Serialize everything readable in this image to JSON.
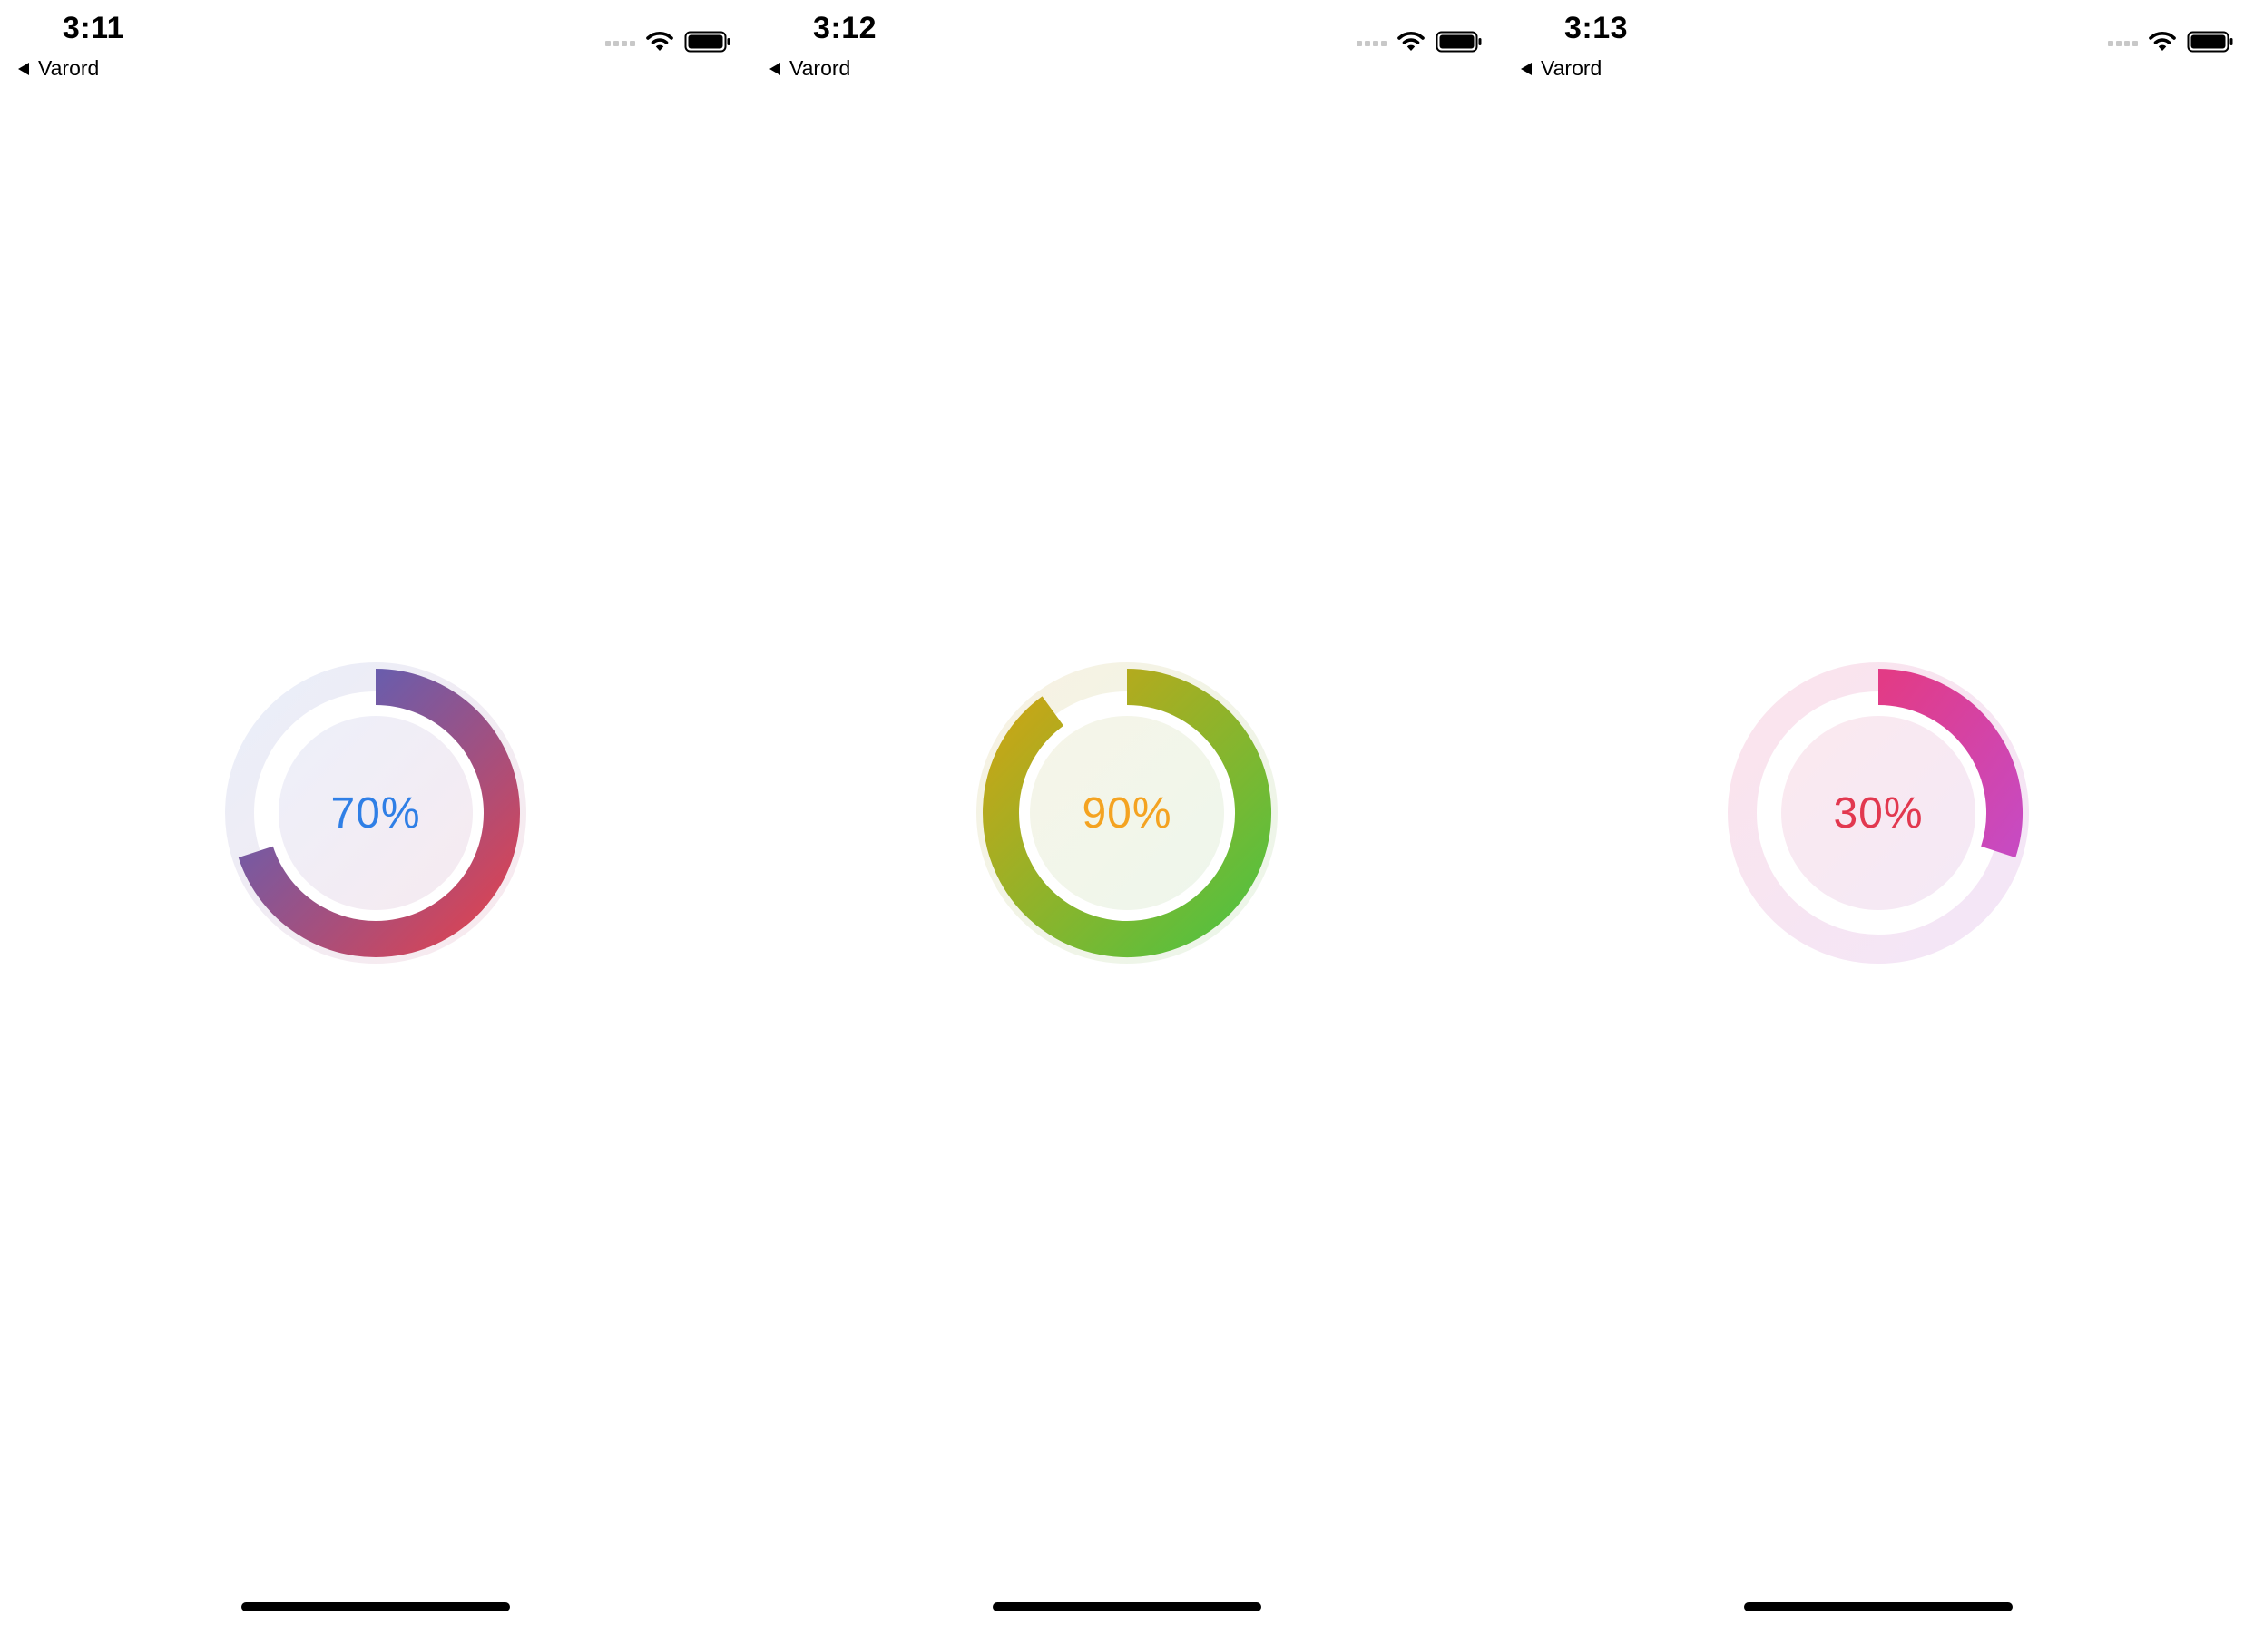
{
  "screens": [
    {
      "status": {
        "time": "3:11",
        "back_label": "Varord"
      },
      "progress": {
        "value": 0.7,
        "label": "70%"
      },
      "colors": {
        "label": "#2f7fe6",
        "track_start": "#e9eef9",
        "track_end": "#f9eaee",
        "inner_start": "#edf0fa",
        "inner_end": "#f6eaf0",
        "arc_start": "#4964c6",
        "arc_end": "#e0424f"
      }
    },
    {
      "status": {
        "time": "3:12",
        "back_label": "Varord"
      },
      "progress": {
        "value": 0.9,
        "label": "90%"
      },
      "colors": {
        "label": "#f4a321",
        "track_start": "#f7f2e3",
        "track_end": "#ecf6ea",
        "inner_start": "#f6f5e8",
        "inner_end": "#eef6ec",
        "arc_start": "#cfa414",
        "arc_end": "#4fc241"
      }
    },
    {
      "status": {
        "time": "3:13",
        "back_label": "Varord"
      },
      "progress": {
        "value": 0.3,
        "label": "30%"
      },
      "colors": {
        "label": "#e2384f",
        "track_start": "#fbe4ec",
        "track_end": "#f3e6f8",
        "inner_start": "#fbe9ef",
        "inner_end": "#f4e9f6",
        "arc_start": "#e23b86",
        "arc_end": "#c84ac0"
      }
    }
  ]
}
